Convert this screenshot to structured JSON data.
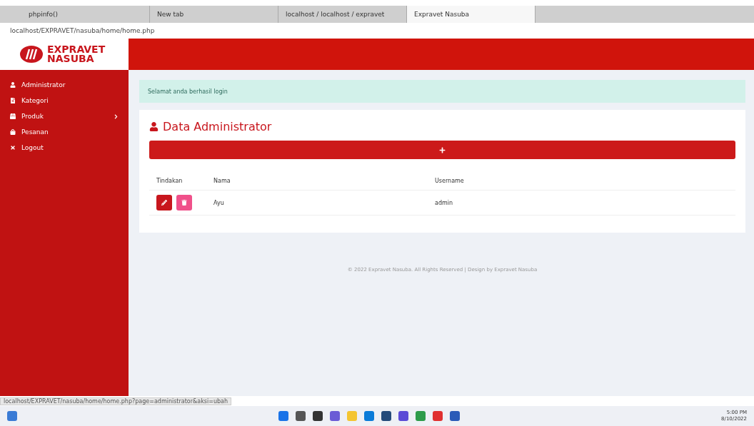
{
  "browser": {
    "tabs": [
      {
        "label": "phpinfo()",
        "selected": false
      },
      {
        "label": "New tab",
        "selected": false
      },
      {
        "label": "localhost / localhost / expravet",
        "selected": false
      },
      {
        "label": "Expravet Nasuba",
        "selected": true
      }
    ],
    "url": "localhost/EXPRAVET/nasuba/home/home.php"
  },
  "brand": {
    "line1": "EXPRAVET",
    "line2": "NASUBA"
  },
  "sidebar": {
    "items": [
      {
        "label": "Administrator",
        "kind": "user",
        "submenu": false
      },
      {
        "label": "Kategori",
        "kind": "file",
        "submenu": false
      },
      {
        "label": "Produk",
        "kind": "box",
        "submenu": true
      },
      {
        "label": "Pesanan",
        "kind": "bag",
        "submenu": false
      },
      {
        "label": "Logout",
        "kind": "close",
        "submenu": false
      }
    ]
  },
  "alert": "Selamat anda berhasil login",
  "card": {
    "title": "Data Administrator",
    "table": {
      "columns": [
        "Tindakan",
        "Nama",
        "Username"
      ],
      "rows": [
        {
          "nama": "Ayu",
          "username": "admin"
        }
      ]
    }
  },
  "footer": "© 2022 Expravet Nasuba. All Rights Reserved | Design by Expravet Nasuba",
  "status_url": "localhost/EXPRAVET/nasuba/home/home.php?page=administrator&aksi=ubah",
  "taskbar": {
    "time": "5:00 PM",
    "date": "8/10/2022"
  }
}
